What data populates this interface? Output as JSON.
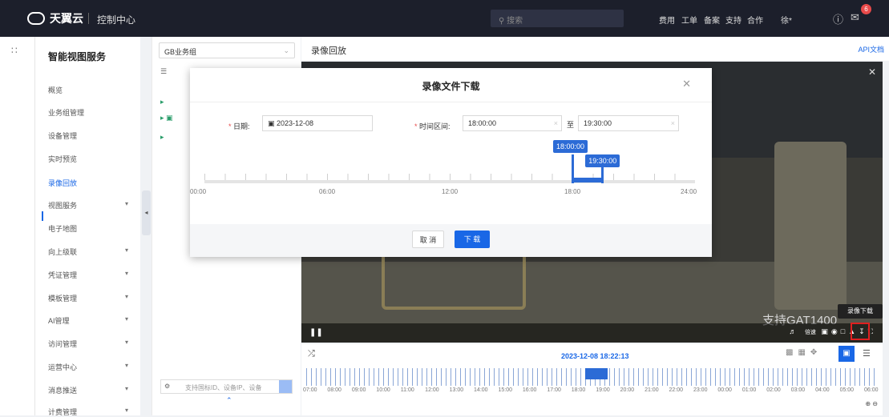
{
  "topbar": {
    "brand": "天翼云",
    "console": "控制中心",
    "search_placeholder": "搜索",
    "nav": [
      "费用",
      "工单",
      "备案",
      "支持",
      "合作"
    ],
    "user": "徐*",
    "notif_count": "6"
  },
  "sidebar": {
    "title": "智能视图服务",
    "items": [
      {
        "label": "概览",
        "arrow": false
      },
      {
        "label": "业务组管理",
        "arrow": false
      },
      {
        "label": "设备管理",
        "arrow": false
      },
      {
        "label": "实时预览",
        "arrow": false
      },
      {
        "label": "录像回放",
        "arrow": false,
        "active": true
      },
      {
        "label": "视图服务",
        "arrow": true
      },
      {
        "label": "电子地图",
        "arrow": false
      },
      {
        "label": "向上级联",
        "arrow": true
      },
      {
        "label": "凭证管理",
        "arrow": true
      },
      {
        "label": "模板管理",
        "arrow": true
      },
      {
        "label": "AI管理",
        "arrow": true
      },
      {
        "label": "访问管理",
        "arrow": true
      },
      {
        "label": "运营中心",
        "arrow": true
      },
      {
        "label": "消息推送",
        "arrow": true
      },
      {
        "label": "计费管理",
        "arrow": true
      }
    ]
  },
  "tree": {
    "group_select": "GB业务组",
    "search_placeholder": "支持国标ID、设备IP、设备"
  },
  "main": {
    "title": "录像回放",
    "api_link": "API文档",
    "watermark": "支持GAT1400",
    "speed_label": "倍速",
    "download_tooltip": "录像下载",
    "current_time": "2023-12-08 18:22:13",
    "timeline_labels": [
      "07:00",
      "08:00",
      "09:00",
      "10:00",
      "11:00",
      "12:00",
      "13:00",
      "14:00",
      "15:00",
      "16:00",
      "17:00",
      "18:00",
      "19:00",
      "20:00",
      "21:00",
      "22:00",
      "23:00",
      "00:00",
      "01:00",
      "02:00",
      "03:00",
      "04:00",
      "05:00",
      "06:00"
    ]
  },
  "modal": {
    "title": "录像文件下载",
    "date_label": "日期:",
    "date_value": "2023-12-08",
    "range_label": "时间区间:",
    "start_time": "18:00:00",
    "to_label": "至",
    "end_time": "19:30:00",
    "range_start_hours": 18,
    "range_end_hours": 19.5,
    "scale_labels": [
      "00:00",
      "06:00",
      "12:00",
      "18:00",
      "24:00"
    ],
    "cancel_label": "取 消",
    "download_label": "下 载"
  },
  "colors": {
    "accent": "#1967e6",
    "topbar_bg": "#1c1f2b",
    "highlight": "#e02020"
  }
}
